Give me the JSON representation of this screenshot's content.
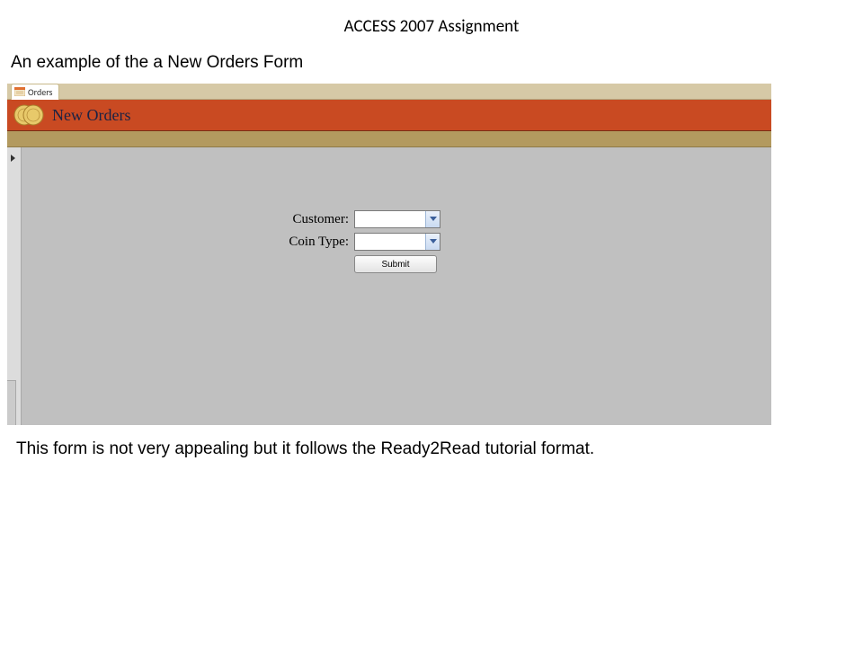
{
  "page_title": "ACCESS 2007 Assignment",
  "subtitle": "An example of the a New Orders Form",
  "tab": {
    "label": "Orders"
  },
  "header": {
    "title": "New Orders"
  },
  "form": {
    "customer_label": "Customer:",
    "customer_value": "",
    "cointype_label": "Coin Type:",
    "cointype_value": "",
    "submit_label": "Submit"
  },
  "footer_text": "This form is not very appealing but it follows the Ready2Read tutorial format."
}
